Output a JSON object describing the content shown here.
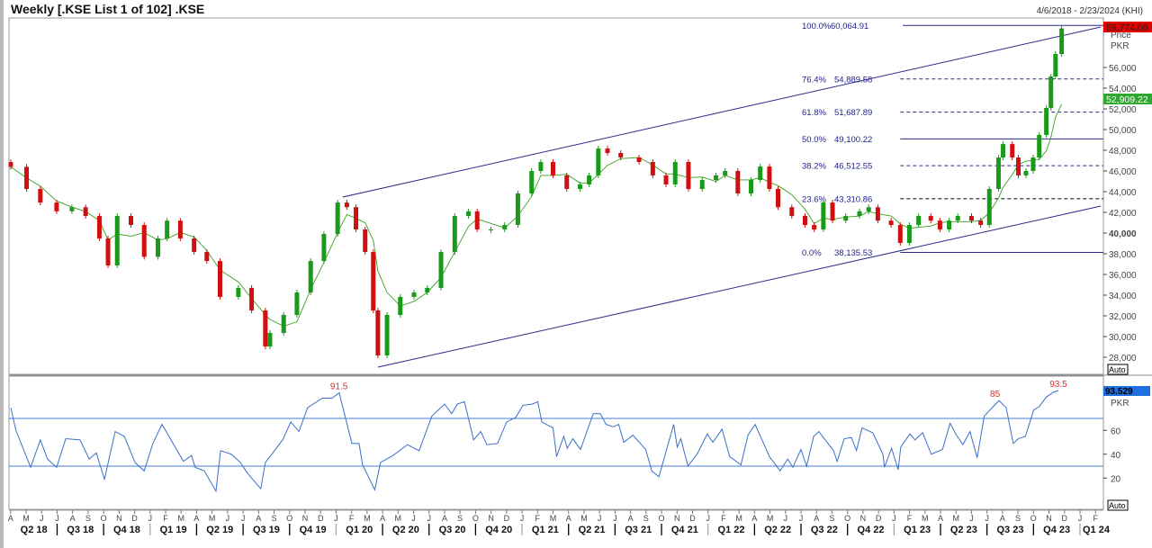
{
  "header": {
    "title": "Weekly [.KSE List 1 of 102] .KSE",
    "date_range": "4/6/2018 - 2/23/2024 (KHI)"
  },
  "chart_data": [
    {
      "type": "candlestick",
      "panel": "price",
      "axis_unit": "Price",
      "currency": "PKR",
      "ylim": [
        27000,
        61000
      ],
      "y_ticks": [
        28000,
        30000,
        32000,
        34000,
        36000,
        38000,
        40000,
        42000,
        44000,
        46000,
        48000,
        50000,
        52000,
        54000,
        56000
      ],
      "y_tick_labels": [
        "28,000",
        "30,000",
        "32,000",
        "34,000",
        "36,000",
        "38,000",
        "40,000",
        "42,000",
        "44,000",
        "46,000",
        "48,000",
        "50,000",
        "52,000",
        "54,000",
        "56,000"
      ],
      "bold_tick": "40,000",
      "last_price_label": "59,774.06",
      "ma_label": "52,909.22",
      "auto_label": "Auto",
      "colors": {
        "up": "#1a9a1a",
        "down": "#d01010",
        "ma": "#3aa020",
        "channel": "#2a2a8a",
        "fib": "#2a2a8a",
        "last": "#e00000",
        "ma_box": "#2ea82e"
      },
      "closes": [
        [
          "2018-04-06",
          46400
        ],
        [
          "2018-05-07",
          44260
        ],
        [
          "2018-06-03",
          42950
        ],
        [
          "2018-07-05",
          42100
        ],
        [
          "2018-08-04",
          42500
        ],
        [
          "2018-08-31",
          41650
        ],
        [
          "2018-09-27",
          39480
        ],
        [
          "2018-10-14",
          36870
        ],
        [
          "2018-11-01",
          41650
        ],
        [
          "2018-11-28",
          40780
        ],
        [
          "2018-12-24",
          37700
        ],
        [
          "2019-01-20",
          39480
        ],
        [
          "2019-02-07",
          41200
        ],
        [
          "2019-03-05",
          39480
        ],
        [
          "2019-04-01",
          38170
        ],
        [
          "2019-04-26",
          37300
        ],
        [
          "2019-05-22",
          33830
        ],
        [
          "2019-06-27",
          34700
        ],
        [
          "2019-07-23",
          32520
        ],
        [
          "2019-08-19",
          29040
        ],
        [
          "2019-08-28",
          30350
        ],
        [
          "2019-09-24",
          32090
        ],
        [
          "2019-10-20",
          34260
        ],
        [
          "2019-11-16",
          37300
        ],
        [
          "2019-12-12",
          39910
        ],
        [
          "2020-01-08",
          42950
        ],
        [
          "2020-01-26",
          42500
        ],
        [
          "2020-02-13",
          40350
        ],
        [
          "2020-03-02",
          38170
        ],
        [
          "2020-03-18",
          32520
        ],
        [
          "2020-03-27",
          28170
        ],
        [
          "2020-04-14",
          32090
        ],
        [
          "2020-05-10",
          33830
        ],
        [
          "2020-06-06",
          34260
        ],
        [
          "2020-07-02",
          34700
        ],
        [
          "2020-07-29",
          38170
        ],
        [
          "2020-08-25",
          41650
        ],
        [
          "2020-09-21",
          42100
        ],
        [
          "2020-10-08",
          40350
        ],
        [
          "2020-11-04",
          40350
        ],
        [
          "2020-12-01",
          40780
        ],
        [
          "2020-12-27",
          43830
        ],
        [
          "2021-01-23",
          46000
        ],
        [
          "2021-02-10",
          46870
        ],
        [
          "2021-03-06",
          45570
        ],
        [
          "2021-04-02",
          44260
        ],
        [
          "2021-04-28",
          44700
        ],
        [
          "2021-05-16",
          45570
        ],
        [
          "2021-06-03",
          48170
        ],
        [
          "2021-06-21",
          47740
        ],
        [
          "2021-07-17",
          47300
        ],
        [
          "2021-08-22",
          46870
        ],
        [
          "2021-09-18",
          45570
        ],
        [
          "2021-10-14",
          44700
        ],
        [
          "2021-11-01",
          46870
        ],
        [
          "2021-11-27",
          44260
        ],
        [
          "2021-12-24",
          45130
        ],
        [
          "2022-01-20",
          45570
        ],
        [
          "2022-02-07",
          46000
        ],
        [
          "2022-03-04",
          43830
        ],
        [
          "2022-03-30",
          45130
        ],
        [
          "2022-04-17",
          46430
        ],
        [
          "2022-05-05",
          44260
        ],
        [
          "2022-05-22",
          42500
        ],
        [
          "2022-06-18",
          41650
        ],
        [
          "2022-07-14",
          40780
        ],
        [
          "2022-08-01",
          40350
        ],
        [
          "2022-08-19",
          42950
        ],
        [
          "2022-09-06",
          41200
        ],
        [
          "2022-10-02",
          41650
        ],
        [
          "2022-10-29",
          42100
        ],
        [
          "2022-11-16",
          42500
        ],
        [
          "2022-12-04",
          41200
        ],
        [
          "2022-12-30",
          40780
        ],
        [
          "2023-01-17",
          39040
        ],
        [
          "2023-02-04",
          40780
        ],
        [
          "2023-02-22",
          41650
        ],
        [
          "2023-03-18",
          41200
        ],
        [
          "2023-04-05",
          40350
        ],
        [
          "2023-04-23",
          41200
        ],
        [
          "2023-05-10",
          41650
        ],
        [
          "2023-06-06",
          41200
        ],
        [
          "2023-06-24",
          40780
        ],
        [
          "2023-07-11",
          44260
        ],
        [
          "2023-07-29",
          47300
        ],
        [
          "2023-08-07",
          48600
        ],
        [
          "2023-08-25",
          47300
        ],
        [
          "2023-09-06",
          45570
        ],
        [
          "2023-09-21",
          46000
        ],
        [
          "2023-10-05",
          47300
        ],
        [
          "2023-10-17",
          49480
        ],
        [
          "2023-10-31",
          52090
        ],
        [
          "2023-11-09",
          55130
        ],
        [
          "2023-11-18",
          57300
        ],
        [
          "2023-11-30",
          59774.06
        ]
      ],
      "channel_lines": [
        {
          "from": [
            "2020-01-18",
            43480
          ],
          "to": [
            "2024-02-15",
            59910
          ]
        },
        {
          "from": [
            "2020-03-27",
            27040
          ],
          "to": [
            "2024-02-15",
            42610
          ]
        }
      ],
      "fibonacci": {
        "start_date": "2023-01-17",
        "levels": [
          {
            "pct": "100.0%",
            "value": 60064.91,
            "label": "60,064.91",
            "style": "solid"
          },
          {
            "pct": "76.4%",
            "value": 54889.58,
            "label": "54,889.58",
            "style": "dashed"
          },
          {
            "pct": "61.8%",
            "value": 51687.89,
            "label": "51,687.89",
            "style": "dashed"
          },
          {
            "pct": "50.0%",
            "value": 49100.22,
            "label": "49,100.22",
            "style": "solid"
          },
          {
            "pct": "38.2%",
            "value": 46512.55,
            "label": "46,512.55",
            "style": "dashed"
          },
          {
            "pct": "23.6%",
            "value": 43310.86,
            "label": "43,310.86",
            "style": "black-dashed"
          },
          {
            "pct": "0.0%",
            "value": 38135.53,
            "label": "38,135.53",
            "style": "solid"
          }
        ]
      }
    },
    {
      "type": "line",
      "panel": "rsi",
      "ylim": [
        0,
        100
      ],
      "y_ticks": [
        20,
        40,
        60
      ],
      "y_tick_labels": [
        "20",
        "40",
        "60"
      ],
      "bands": [
        30,
        70
      ],
      "last_value_label": "93.529",
      "currency": "PKR",
      "auto_label": "Auto",
      "colors": {
        "line": "#3a6fc8",
        "band": "#4a7fcf",
        "last": "#1e6fe0",
        "annotation": "#d03030"
      },
      "annotations": [
        [
          "2020-01-11",
          91.5,
          "91.5"
        ],
        [
          "2023-07-30",
          85,
          "85"
        ],
        [
          "2023-11-24",
          93.5,
          "93.5"
        ]
      ],
      "values": [
        [
          "2018-04-06",
          79
        ],
        [
          "2018-04-16",
          60
        ],
        [
          "2018-05-15",
          29
        ],
        [
          "2018-06-03",
          52
        ],
        [
          "2018-06-17",
          36
        ],
        [
          "2018-07-05",
          29
        ],
        [
          "2018-07-23",
          53
        ],
        [
          "2018-08-20",
          52
        ],
        [
          "2018-09-07",
          36
        ],
        [
          "2018-09-21",
          41
        ],
        [
          "2018-10-07",
          19
        ],
        [
          "2018-10-28",
          59
        ],
        [
          "2018-11-15",
          55
        ],
        [
          "2018-12-06",
          33
        ],
        [
          "2018-12-24",
          26
        ],
        [
          "2019-01-10",
          49
        ],
        [
          "2019-01-28",
          65
        ],
        [
          "2019-03-11",
          34
        ],
        [
          "2019-03-27",
          39
        ],
        [
          "2019-04-03",
          29
        ],
        [
          "2019-04-21",
          26
        ],
        [
          "2019-05-14",
          9
        ],
        [
          "2019-05-23",
          43
        ],
        [
          "2019-06-13",
          40
        ],
        [
          "2019-07-01",
          33
        ],
        [
          "2019-07-15",
          24
        ],
        [
          "2019-08-10",
          11
        ],
        [
          "2019-08-19",
          33
        ],
        [
          "2019-09-22",
          52
        ],
        [
          "2019-10-08",
          67
        ],
        [
          "2019-10-24",
          59
        ],
        [
          "2019-11-10",
          79
        ],
        [
          "2019-12-09",
          87
        ],
        [
          "2019-12-28",
          87
        ],
        [
          "2020-01-11",
          91.5
        ],
        [
          "2020-02-05",
          49
        ],
        [
          "2020-02-19",
          49
        ],
        [
          "2020-02-26",
          31
        ],
        [
          "2020-03-21",
          10
        ],
        [
          "2020-04-01",
          33
        ],
        [
          "2020-04-26",
          39
        ],
        [
          "2020-05-24",
          48
        ],
        [
          "2020-06-16",
          43
        ],
        [
          "2020-07-11",
          72
        ],
        [
          "2020-08-05",
          82
        ],
        [
          "2020-08-19",
          74
        ],
        [
          "2020-08-30",
          82
        ],
        [
          "2020-09-13",
          84
        ],
        [
          "2020-10-01",
          52
        ],
        [
          "2020-10-15",
          59
        ],
        [
          "2020-10-27",
          48
        ],
        [
          "2020-11-17",
          49
        ],
        [
          "2020-12-05",
          67
        ],
        [
          "2020-12-23",
          71
        ],
        [
          "2021-01-06",
          81
        ],
        [
          "2021-01-24",
          82
        ],
        [
          "2021-02-04",
          84
        ],
        [
          "2021-02-12",
          67
        ],
        [
          "2021-03-06",
          62
        ],
        [
          "2021-03-13",
          38
        ],
        [
          "2021-03-27",
          55
        ],
        [
          "2021-04-03",
          45
        ],
        [
          "2021-04-14",
          53
        ],
        [
          "2021-04-29",
          44
        ],
        [
          "2021-05-24",
          74
        ],
        [
          "2021-06-07",
          74
        ],
        [
          "2021-06-18",
          65
        ],
        [
          "2021-07-02",
          63
        ],
        [
          "2021-07-13",
          65
        ],
        [
          "2021-07-23",
          50
        ],
        [
          "2021-08-10",
          56
        ],
        [
          "2021-09-04",
          44
        ],
        [
          "2021-09-16",
          26
        ],
        [
          "2021-09-30",
          21
        ],
        [
          "2021-10-29",
          65
        ],
        [
          "2021-11-05",
          46
        ],
        [
          "2021-11-12",
          53
        ],
        [
          "2021-11-26",
          30
        ],
        [
          "2021-12-14",
          40
        ],
        [
          "2022-01-03",
          57
        ],
        [
          "2022-01-14",
          50
        ],
        [
          "2022-02-01",
          61
        ],
        [
          "2022-02-16",
          38
        ],
        [
          "2022-03-10",
          31
        ],
        [
          "2022-03-24",
          56
        ],
        [
          "2022-04-07",
          65
        ],
        [
          "2022-05-05",
          38
        ],
        [
          "2022-05-26",
          26
        ],
        [
          "2022-06-10",
          36
        ],
        [
          "2022-06-20",
          29
        ],
        [
          "2022-07-06",
          44
        ],
        [
          "2022-07-17",
          30
        ],
        [
          "2022-07-31",
          55
        ],
        [
          "2022-08-10",
          59
        ],
        [
          "2022-09-08",
          43
        ],
        [
          "2022-09-15",
          34
        ],
        [
          "2022-09-29",
          53
        ],
        [
          "2022-10-13",
          54
        ],
        [
          "2022-10-23",
          43
        ],
        [
          "2022-11-03",
          62
        ],
        [
          "2022-11-24",
          58
        ],
        [
          "2022-12-14",
          40
        ],
        [
          "2022-12-17",
          29
        ],
        [
          "2022-12-31",
          45
        ],
        [
          "2023-01-13",
          27
        ],
        [
          "2023-01-18",
          46
        ],
        [
          "2023-02-05",
          57
        ],
        [
          "2023-02-15",
          52
        ],
        [
          "2023-03-02",
          58
        ],
        [
          "2023-03-19",
          40
        ],
        [
          "2023-04-10",
          44
        ],
        [
          "2023-04-25",
          66
        ],
        [
          "2023-05-06",
          57
        ],
        [
          "2023-05-20",
          48
        ],
        [
          "2023-06-03",
          59
        ],
        [
          "2023-06-17",
          37
        ],
        [
          "2023-07-01",
          72
        ],
        [
          "2023-07-30",
          85
        ],
        [
          "2023-08-13",
          79
        ],
        [
          "2023-08-27",
          49
        ],
        [
          "2023-09-06",
          53
        ],
        [
          "2023-09-20",
          55
        ],
        [
          "2023-10-06",
          77
        ],
        [
          "2023-10-17",
          80
        ],
        [
          "2023-10-31",
          88
        ],
        [
          "2023-11-14",
          92
        ],
        [
          "2023-11-24",
          93.5
        ]
      ]
    }
  ],
  "x_axis": {
    "month_letters": [
      "A",
      "M",
      "J",
      "J",
      "A",
      "S",
      "O",
      "N",
      "D",
      "J",
      "F",
      "M",
      "A",
      "M",
      "J",
      "J",
      "A",
      "S",
      "O",
      "N",
      "D",
      "J",
      "F",
      "M",
      "A",
      "M",
      "J",
      "J",
      "A",
      "S",
      "O",
      "N",
      "D",
      "J",
      "F",
      "M",
      "A",
      "M",
      "J",
      "J",
      "A",
      "S",
      "O",
      "N",
      "D",
      "J",
      "F",
      "M",
      "A",
      "M",
      "J",
      "J",
      "A",
      "S",
      "O",
      "N",
      "D",
      "J",
      "F",
      "M",
      "A",
      "M",
      "J",
      "J",
      "A",
      "S",
      "O",
      "N",
      "D",
      "J",
      "F"
    ],
    "quarters": [
      "Q2 18",
      "Q3 18",
      "Q4 18",
      "Q1 19",
      "Q2 19",
      "Q3 19",
      "Q4 19",
      "Q1 20",
      "Q2 20",
      "Q3 20",
      "Q4 20",
      "Q1 21",
      "Q2 21",
      "Q3 21",
      "Q4 21",
      "Q1 22",
      "Q2 22",
      "Q3 22",
      "Q4 22",
      "Q1 23",
      "Q2 23",
      "Q3 23",
      "Q4 23",
      "Q1 24"
    ]
  }
}
